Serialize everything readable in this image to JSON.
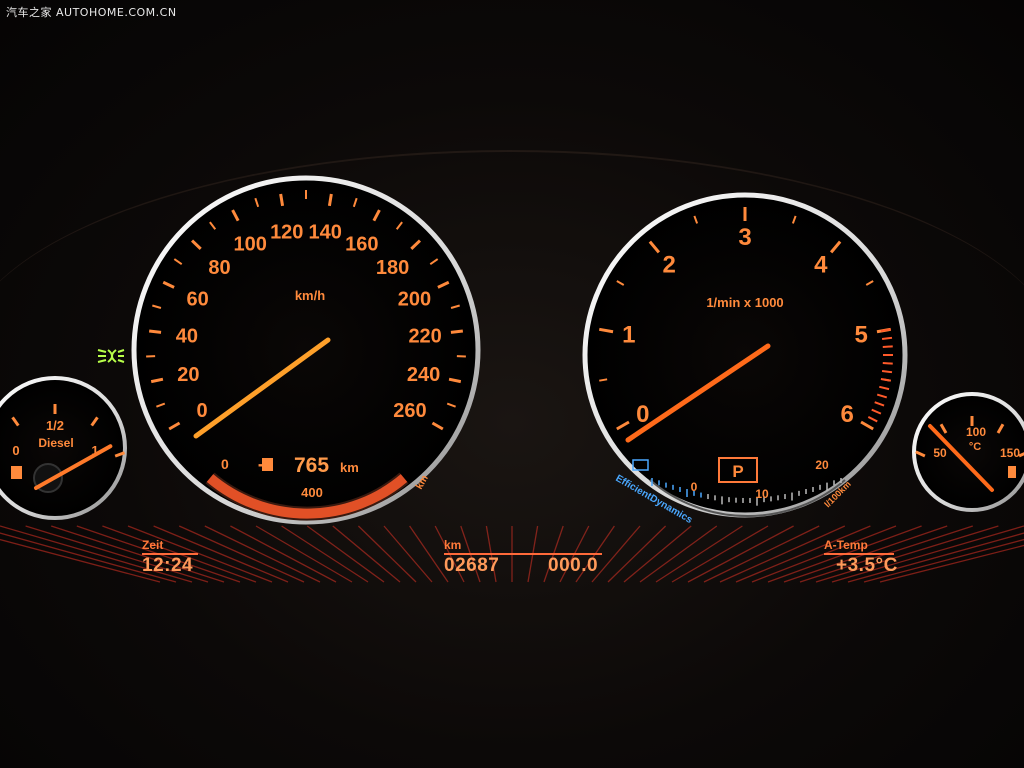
{
  "watermark": "汽车之家  AUTOHOME.COM.CN",
  "speedometer": {
    "unit": "km/h",
    "labels": [
      "0",
      "20",
      "40",
      "60",
      "80",
      "100",
      "120",
      "140",
      "160",
      "180",
      "200",
      "220",
      "240",
      "260"
    ],
    "needle_value_kmh": 30,
    "max_kmh": 260
  },
  "range_display": {
    "start": "0",
    "range_value": "765",
    "range_unit": "km",
    "scale_mid": "400",
    "scale_unit": "km"
  },
  "tachometer": {
    "unit": "1/min x 1000",
    "labels": [
      "0",
      "1",
      "2",
      "3",
      "4",
      "5",
      "6"
    ],
    "needle_value_rpm_k": 0.7
  },
  "gear_indicator": "P",
  "consumption_gauge": {
    "labels": [
      "0",
      "10",
      "20"
    ],
    "unit": "l/100km",
    "brand": "EfficientDynamics"
  },
  "fuel_gauge": {
    "label_empty": "0",
    "label_half": "1/2",
    "label_full": "1",
    "fuel_type": "Diesel",
    "level_fraction": 0.95
  },
  "temp_gauge": {
    "labels": [
      "50",
      "100",
      "150"
    ],
    "unit": "°C",
    "needle_value": 75
  },
  "lcd": {
    "zeit_label": "Zeit",
    "zeit_value": "12:24",
    "km_label": "km",
    "odometer": "02687",
    "trip": "000.0",
    "atemp_label": "A-Temp",
    "atemp_value": "+3.5°C"
  },
  "colors": {
    "scale": "#ff8a3c",
    "needle": "#ff9a2a",
    "rim": "#f2f2f2",
    "lcd": "#ff6a3a",
    "indicator_green": "#b8ff4a",
    "eco_blue": "#4aa8ff"
  }
}
